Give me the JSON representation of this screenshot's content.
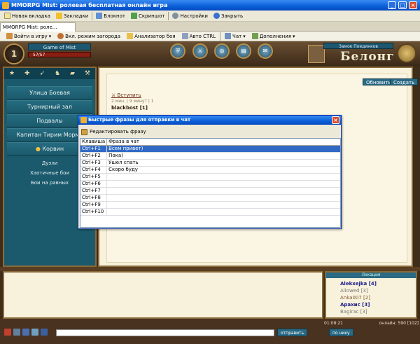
{
  "window": {
    "title": "MMORPG Mist: ролевая бесплатная онлайн игра"
  },
  "toolbar": {
    "items": [
      "Новая вкладка",
      "Закладки",
      "Блокнот",
      "Скриншот",
      "Настройки",
      "Закрыть"
    ]
  },
  "tab": {
    "label": "MMORPG Mist: роле..."
  },
  "navbar": {
    "items": [
      "Войти в игру",
      "Вкл. режим загорода",
      "Анализатор боя",
      "Авто CTRL",
      "Чат",
      "Дополнения"
    ]
  },
  "header": {
    "level": "1",
    "char_name": "Game of Mist",
    "hp": "57/57",
    "castle_label": "Замок Поединков",
    "city_name": "Белонг"
  },
  "sidebar": {
    "items": [
      "Улица Боевая",
      "Турнирный зал",
      "Подвалы",
      "Капитан Тирим Мормо",
      "Корвин"
    ],
    "subitems": [
      "Дуэли",
      "Хаотичные бои",
      "Бои на равных"
    ]
  },
  "content": {
    "refresh_label": "Обновить",
    "create_label": "Создать",
    "join_label": "Вступить",
    "meta": "2 мин. | 9 минут | 1",
    "player": "blackbost [1]"
  },
  "dialog": {
    "title": "Быстрые фразы для отправки в чат",
    "edit_label": "Редактировать фразу",
    "col_key": "Клавиша",
    "col_phrase": "Фраза в чат",
    "rows": [
      {
        "key": "Ctrl+F1",
        "phrase": "Всем привет)"
      },
      {
        "key": "Ctrl+F2",
        "phrase": "Пока)"
      },
      {
        "key": "Ctrl+F3",
        "phrase": "Ушел спать"
      },
      {
        "key": "Ctrl+F4",
        "phrase": "Скоро буду"
      },
      {
        "key": "Ctrl+F5",
        "phrase": ""
      },
      {
        "key": "Ctrl+F6",
        "phrase": ""
      },
      {
        "key": "Ctrl+F7",
        "phrase": ""
      },
      {
        "key": "Ctrl+F8",
        "phrase": ""
      },
      {
        "key": "Ctrl+F9",
        "phrase": ""
      },
      {
        "key": "Ctrl+F10",
        "phrase": ""
      }
    ],
    "selected_index": 0
  },
  "online": {
    "title": "Локация",
    "players": [
      {
        "name": "Alekxejka [4]",
        "color": "#1a1a8a"
      },
      {
        "name": "Allowed [3]",
        "color": "#7a7a7a"
      },
      {
        "name": "Anka007 [2]",
        "color": "#7a5a3a"
      },
      {
        "name": "Арахис [3]",
        "color": "#1a1a8a"
      },
      {
        "name": "Bagirac [3]",
        "color": "#7a7a7a"
      }
    ]
  },
  "status": {
    "time": "01:08:21",
    "online": "онлайн: 590 [102]",
    "send_label": "отправить",
    "hand_label": "по нику"
  },
  "colors": {
    "accent": "#1a5a6c",
    "xp_titlebar": "#0a5fd8",
    "selection": "#316ac5"
  }
}
